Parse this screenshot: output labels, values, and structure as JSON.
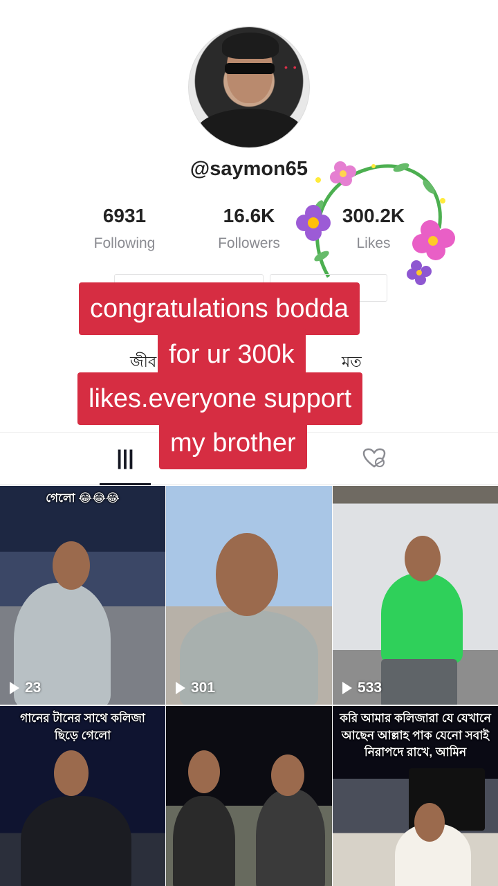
{
  "profile": {
    "username": "@saymon65",
    "bio_left": "জীব",
    "bio_right": "মত"
  },
  "stats": [
    {
      "value": "6931",
      "label": "Following"
    },
    {
      "value": "16.6K",
      "label": "Followers"
    },
    {
      "value": "300.2K",
      "label": "Likes"
    }
  ],
  "tabs": {
    "videos_icon": "grid-icon",
    "liked_icon": "liked-hidden-icon"
  },
  "overlay": {
    "lines": [
      "congratulations bodda",
      "for ur 300k",
      "likes.everyone support",
      "my brother"
    ],
    "color": "#d62d42"
  },
  "videos": [
    {
      "caption": "গেলো 😂😂😂",
      "views": "23"
    },
    {
      "caption": "",
      "views": "301"
    },
    {
      "caption": "",
      "views": "533"
    },
    {
      "caption": "গানের টানের সাথে কলিজা ছিড়ে গেলো",
      "views": ""
    },
    {
      "caption": "",
      "views": ""
    },
    {
      "caption": "করি আমার কলিজারা যে যেখানে আছেন আল্লাহ পাক যেনো সবাই নিরাপদে রাখে, আমিন",
      "views": ""
    }
  ]
}
